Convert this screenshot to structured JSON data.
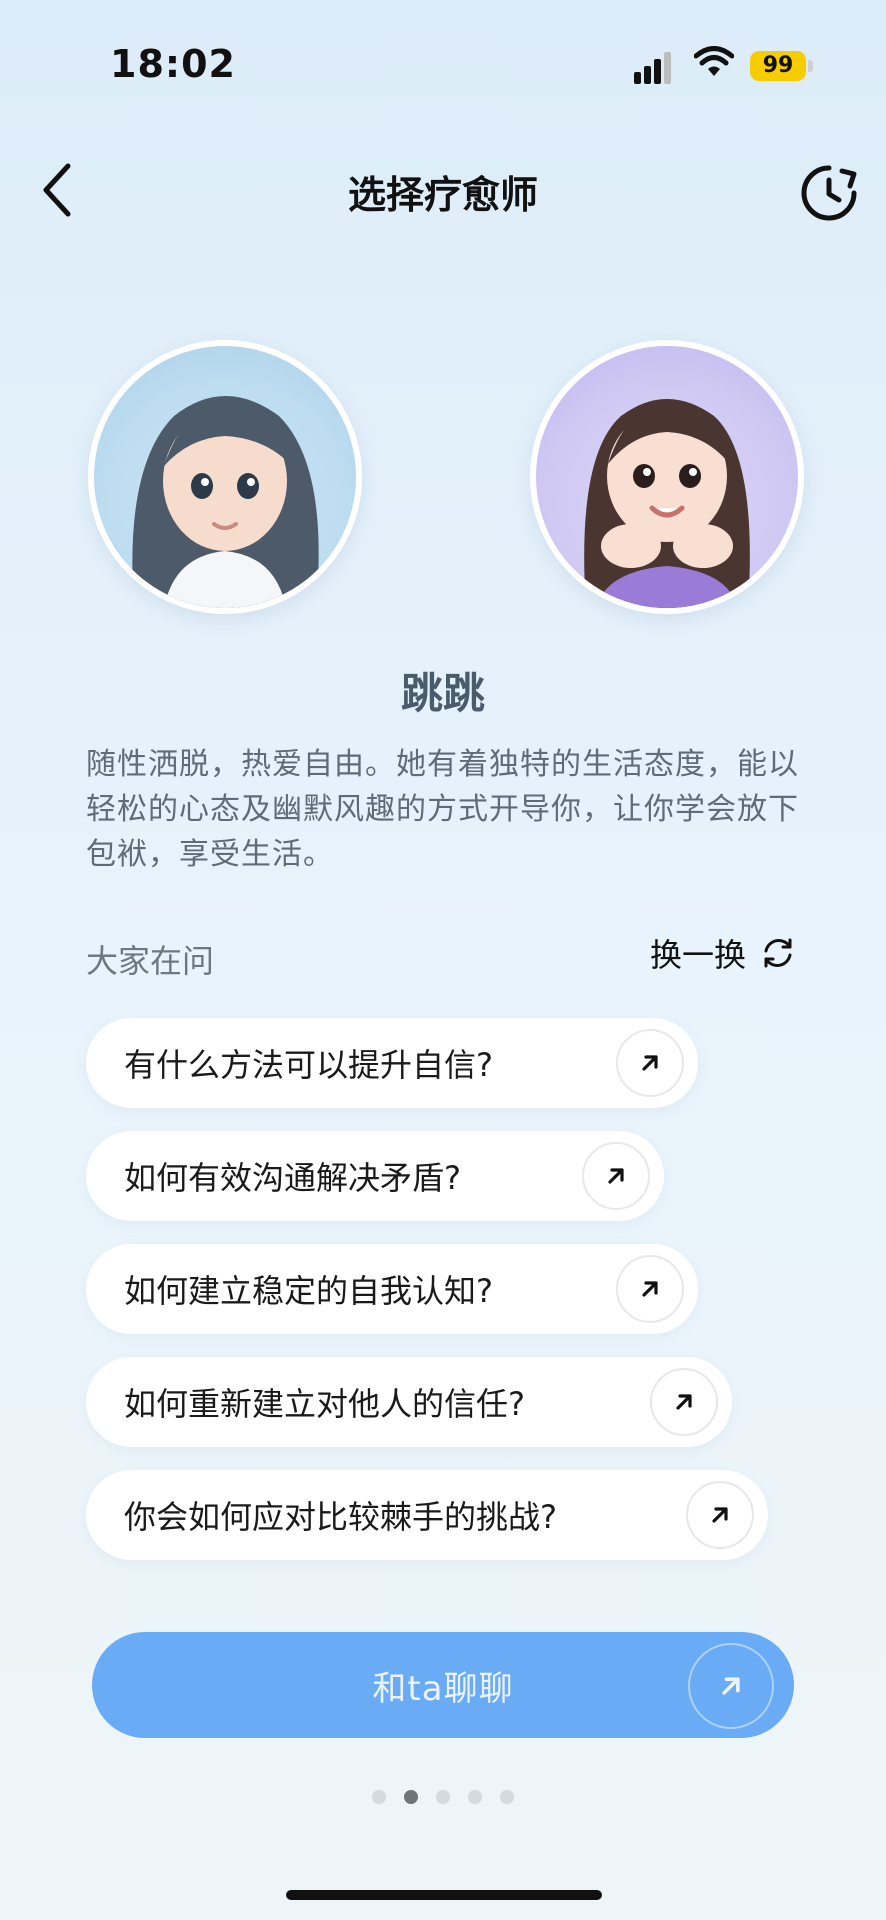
{
  "status_bar": {
    "time": "18:02",
    "battery": "99"
  },
  "header": {
    "title": "选择疗愈师"
  },
  "therapist": {
    "name": "跳跳",
    "description": "随性洒脱，热爱自由。她有着独特的生活态度，能以轻松的心态及幽默风趣的方式开导你，让你学会放下包袱，享受生活。"
  },
  "questions": {
    "label": "大家在问",
    "refresh_label": "换一换",
    "items": [
      "有什么方法可以提升自信?",
      "如何有效沟通解决矛盾?",
      "如何建立稳定的自我认知?",
      "如何重新建立对他人的信任?",
      "你会如何应对比较棘手的挑战?"
    ]
  },
  "cta": {
    "label": "和ta聊聊"
  },
  "pager": {
    "total": 5,
    "active_index": 2
  },
  "colors": {
    "accent": "#6aabf6",
    "battery": "#f6cd00"
  }
}
